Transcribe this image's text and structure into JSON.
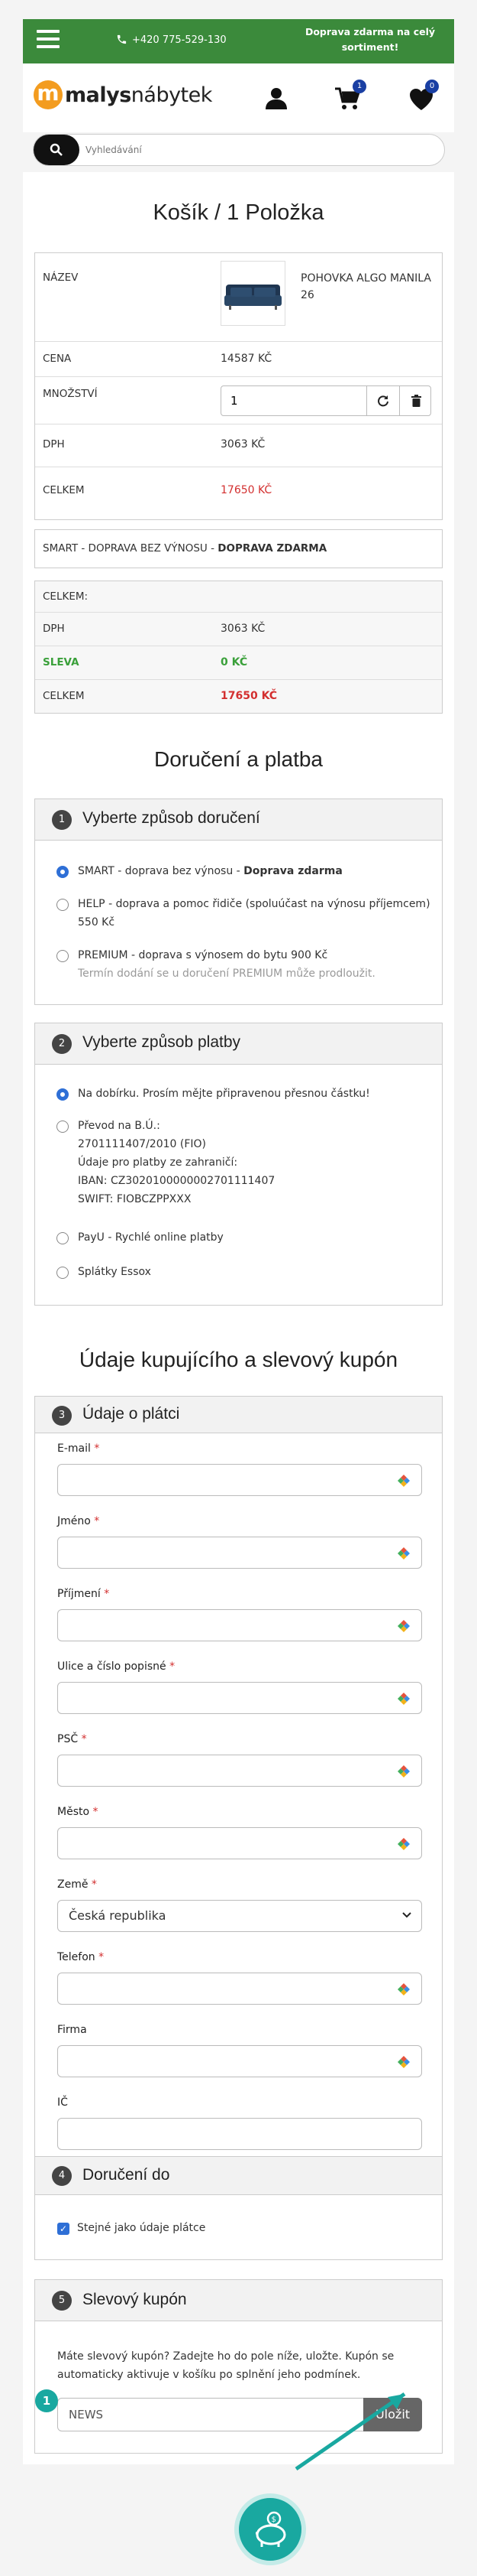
{
  "header": {
    "phone": "+420 775-529-130",
    "shipping_banner": "Doprava zdarma na celý sortiment!",
    "logo_m": "m",
    "logo_part1": "malys",
    "logo_part2": "nábytek",
    "cart_badge": "1",
    "wishlist_badge": "0",
    "search_placeholder": "Vyhledávání"
  },
  "cart": {
    "title": "Košík / 1 Položka",
    "name_label": "NÁZEV",
    "product_name": "POHOVKA ALGO MANILA 26",
    "price_label": "CENA",
    "price_value": "14587 Kč",
    "qty_label": "MNOŽSTVÍ",
    "qty_value": "1",
    "vat_label": "DPH",
    "vat_value": "3063 Kč",
    "total_label": "CELKEM",
    "total_value": "17650 Kč",
    "shipping_row": "SMART - DOPRAVA BEZ VÝNOSU - ",
    "shipping_row_bold": "DOPRAVA ZDARMA",
    "summary_label": "CELKEM:",
    "sum_vat_label": "DPH",
    "sum_vat_value": "3063 Kč",
    "discount_label": "SLEVA",
    "discount_value": "0 Kč",
    "sum_total_label": "CELKEM",
    "sum_total_value": "17650 Kč"
  },
  "delivery": {
    "title": "Doručení a platba",
    "step1_num": "1",
    "step1_title": "Vyberte způsob doručení",
    "opt_smart": "SMART - doprava bez výnosu - ",
    "opt_smart_bold": "Doprava zdarma",
    "opt_help": "HELP - doprava a pomoc řidiče (spoluúčast na výnosu příjemcem) 550 Kč",
    "opt_premium": "PREMIUM - doprava s výnosem do bytu 900 Kč",
    "opt_premium_note": "Termín dodání se u doručení PREMIUM může prodloužit.",
    "step2_num": "2",
    "step2_title": "Vyberte způsob platby",
    "pay_cod": "Na dobírku. Prosím mějte připravenou přesnou částku!",
    "pay_transfer_l1": "Převod na B.Ú.:",
    "pay_transfer_l2": "2701111407/2010 (FIO)",
    "pay_transfer_l3": "Údaje pro platby ze zahraničí:",
    "pay_transfer_l4": "IBAN: CZ3020100000002701111407",
    "pay_transfer_l5": "SWIFT: FIOBCZPPXXX",
    "pay_payu": "PayU - Rychlé online platby",
    "pay_essox": "Splátky Essox"
  },
  "buyer": {
    "title": "Údaje kupujícího a slevový kupón",
    "step3_num": "3",
    "step3_title": "Údaje o plátci",
    "email": "E-mail",
    "name": "Jméno",
    "surname": "Příjmení",
    "street": "Ulice a číslo popisné",
    "zip": "PSČ",
    "city": "Město",
    "country": "Země",
    "country_value": "Česká republika",
    "phone": "Telefon",
    "company": "Firma",
    "ic": "IČ",
    "required_mark": "*",
    "step4_num": "4",
    "step4_title": "Doručení do",
    "same_as_payer": "Stejné jako údaje plátce",
    "step5_num": "5",
    "step5_title": "Slevový kupón",
    "coupon_text": "Máte slevový kupón? Zadejte ho do pole níže, uložte. Kupón se automaticky aktivuje v košíku po splnění jeho podmínek.",
    "coupon_value": "NEWS",
    "save_label": "Uložit",
    "hint_num": "1"
  },
  "colors": {
    "topbar": "#3b8a3b",
    "accent_blue": "#2e6fd6",
    "logo_orange": "#f39c1f",
    "price_red": "#d32f2f",
    "teal": "#19a8a0"
  },
  "icons": [
    "menu-icon",
    "phone-icon",
    "user-icon",
    "cart-icon",
    "heart-icon",
    "search-icon",
    "refresh-icon",
    "trash-icon",
    "autofill-icon",
    "piggy-bank-icon"
  ]
}
